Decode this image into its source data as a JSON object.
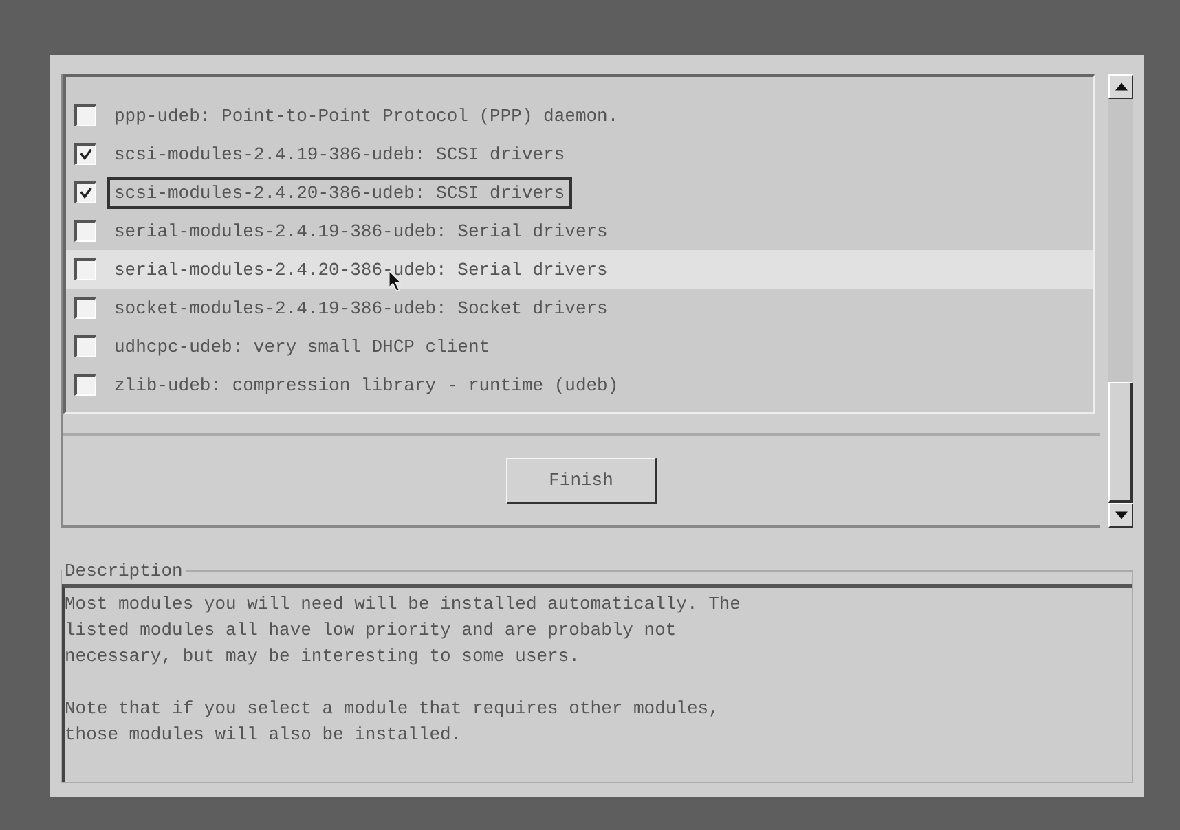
{
  "modules": [
    {
      "label": "ppp-udeb: Point-to-Point Protocol (PPP) daemon.",
      "checked": false,
      "focused": false,
      "hovered": false
    },
    {
      "label": "scsi-modules-2.4.19-386-udeb: SCSI drivers",
      "checked": true,
      "focused": false,
      "hovered": false
    },
    {
      "label": "scsi-modules-2.4.20-386-udeb: SCSI drivers",
      "checked": true,
      "focused": true,
      "hovered": false
    },
    {
      "label": "serial-modules-2.4.19-386-udeb: Serial drivers",
      "checked": false,
      "focused": false,
      "hovered": false
    },
    {
      "label": "serial-modules-2.4.20-386-udeb: Serial drivers",
      "checked": false,
      "focused": false,
      "hovered": true
    },
    {
      "label": "socket-modules-2.4.19-386-udeb: Socket drivers",
      "checked": false,
      "focused": false,
      "hovered": false
    },
    {
      "label": "udhcpc-udeb: very small DHCP client",
      "checked": false,
      "focused": false,
      "hovered": false
    },
    {
      "label": "zlib-udeb: compression library - runtime (udeb)",
      "checked": false,
      "focused": false,
      "hovered": false
    }
  ],
  "finish_button": "Finish",
  "description": {
    "title": "Description",
    "paragraphs": [
      "Most modules you will need will be installed automatically. The\nlisted modules all have low priority and are probably not\nnecessary, but may be interesting to some users.",
      "Note that if you select a module that requires other modules,\nthose modules will also be installed."
    ]
  }
}
